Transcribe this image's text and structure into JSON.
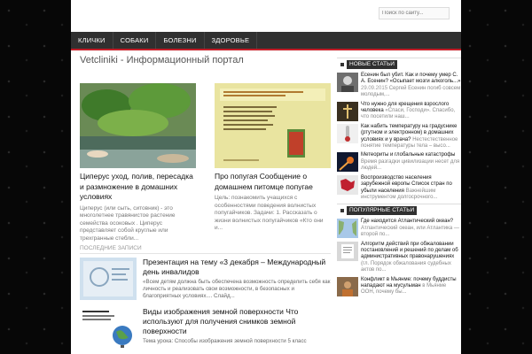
{
  "search": {
    "placeholder": "Поиск по сайту..."
  },
  "nav": {
    "items": [
      "Клички",
      "Собаки",
      "Болезни",
      "Здоровье"
    ]
  },
  "site_title": "Vetcliniki - Информационный портал",
  "featured": [
    {
      "title": "Циперус уход, полив, пересадка и размножение в домашних условиях",
      "excerpt": "Циперус (или сыть, ситовник) - это многолетнее травянистое растение семейства осоковых . Циперус представляет собой круглые или трехгранные стебли..."
    },
    {
      "title": "Про попугая Сообщение о домашнем питомце попугае",
      "excerpt": "Цель: познакомить учащихся с особенностями поведения волнистых попугайчиков. Задачи: 1. Рассказать о жизни волнистых попугайчиков «Кто они и..."
    }
  ],
  "recent": {
    "label": "Последние записи",
    "items": [
      {
        "title": "Презентация на тему «3 декабря – Международный день инвалидов",
        "excerpt": "«Всем детям должна быть обеспечена возможность определить себя как личность и реализовать свои возможности, в безопасных и благоприятных условиях.... Слайд..."
      },
      {
        "title": "Виды изображения земной поверхности Что используют для получения снимков земной поверхности",
        "excerpt": "Тема урока: Способы изображения земной поверхности 5 класс"
      }
    ]
  },
  "sidebar": {
    "new_label": "Новые статьи",
    "new_items": [
      {
        "title": "Есенин был убит. Как и почему умер С. А. Есенин? «Осыпает мозги алкоголь...»",
        "date": "29.09.2015",
        "excerpt": "Сергей Есенин погиб совсем молодым,..."
      },
      {
        "title": "Что нужно для крещения взрослого человека",
        "excerpt": "«Спаси, Господи». Спасибо, что посетили наш..."
      },
      {
        "title": "Как набить температуру на градуснике (ртутном и электронном) в домашних условиях и у врача?",
        "excerpt": "Нестестественное понятие температуры тела – высо..."
      },
      {
        "title": "Метеориты и глобальные катастрофы",
        "excerpt": "Время разгадки цивилизации несет для людей..."
      },
      {
        "title": "Воспроизводство населения зарубежной европы Список стран по убыли населения",
        "excerpt": "Важнейшим инструментом долгосрочного..."
      }
    ],
    "popular_label": "Популярные статьи",
    "popular_items": [
      {
        "title": "Где находится Атлантический океан?",
        "excerpt": "Атлантический океан, или Атлантика — второй по..."
      },
      {
        "title": "Алгоритм действий при обжаловании постановлений и решений по делам об административных правонарушениях",
        "excerpt": "(гл. Порядок обжалования судебных актов по..."
      },
      {
        "title": "Конфликт в Мьянме: почему буддисты нападают на мусульман",
        "excerpt": "в Мьянме ООН, почему бы..."
      }
    ]
  },
  "colors": {
    "accent": "#c41e28",
    "nav_bg": "#303030"
  }
}
